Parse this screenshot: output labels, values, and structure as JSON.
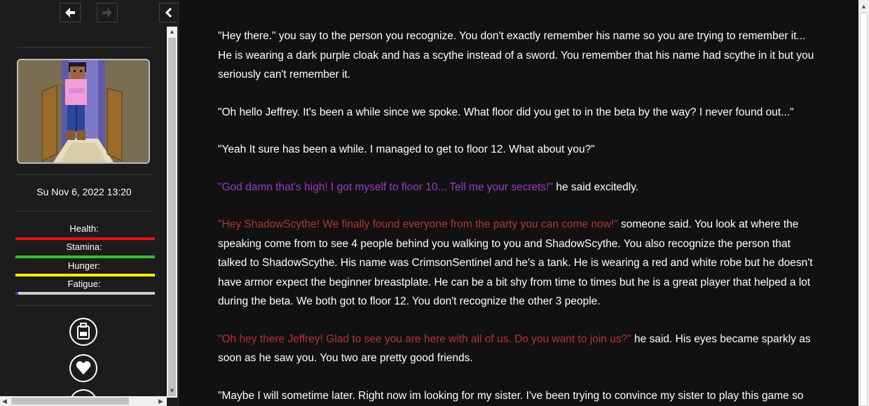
{
  "nav": {
    "back_icon": "left-arrow-icon",
    "forward_icon": "right-arrow-icon",
    "hide_sidebar_icon": "chevron-left-icon"
  },
  "sidebar": {
    "datetime": "Su Nov 6, 2022 13:20",
    "stats": [
      {
        "label": "Health:",
        "level": 1.0,
        "color": "#e61010"
      },
      {
        "label": "Stamina:",
        "level": 1.0,
        "color": "#33c033"
      },
      {
        "label": "Hunger:",
        "level": 1.0,
        "color": "#ffee00"
      },
      {
        "label": "Fatigue:",
        "level": 0.02,
        "color": "#2244ee",
        "track_color": "#cccccc"
      }
    ],
    "icons": [
      "backpack-icon",
      "heart-icon",
      "settings-icon"
    ]
  },
  "story": {
    "p1": "\"Hey there.\" you say to the person you recognize. You don't exactly remember his name so you are trying to remember it... He is wearing a dark purple cloak and has a scythe instead of a sword. You remember that his name had scythe in it but you seriously can't remember it.",
    "p2": "\"Oh hello Jeffrey. It's been a while since we spoke. What floor did you get to in the beta by the way? I never found out...\"",
    "p3": "\"Yeah It sure has been a while. I managed to get to floor 12. What about you?\"",
    "p4_quote": "\"God damn that's high! I got myself to floor 10... Tell me your secrets!\"",
    "p4_rest": " he said excitedly.",
    "p5_quote": "\"Hey ShadowScythe! We finally found everyone from the party you can come now!\"",
    "p5_rest": " someone said. You look at where the speaking come from to see 4 people behind you walking to you and ShadowScythe. You also recognize the person that talked to ShadowScythe. His name was CrimsonSentinel and he's a tank. He is wearing a red and white robe but he doesn't have armor expect the beginner breastplate. He can be a bit shy from time to times but he is a great player that helped a lot during the beta. We both got to floor 12. You don't recognize the other 3 people.",
    "p6_quote": "\"Oh hey there Jeffrey! Glad to see you are here with all of us. Do you want to join us?\"",
    "p6_rest": " he said. His eyes became sparkly as soon as he saw you. You two are pretty good friends.",
    "p7": "\"Maybe I will sometime later. Right now im looking for my sister. I've been trying to convince my sister to play this game so"
  },
  "colors": {
    "purple_speech": "#9b3ac3",
    "red_speech": "#b33434"
  }
}
